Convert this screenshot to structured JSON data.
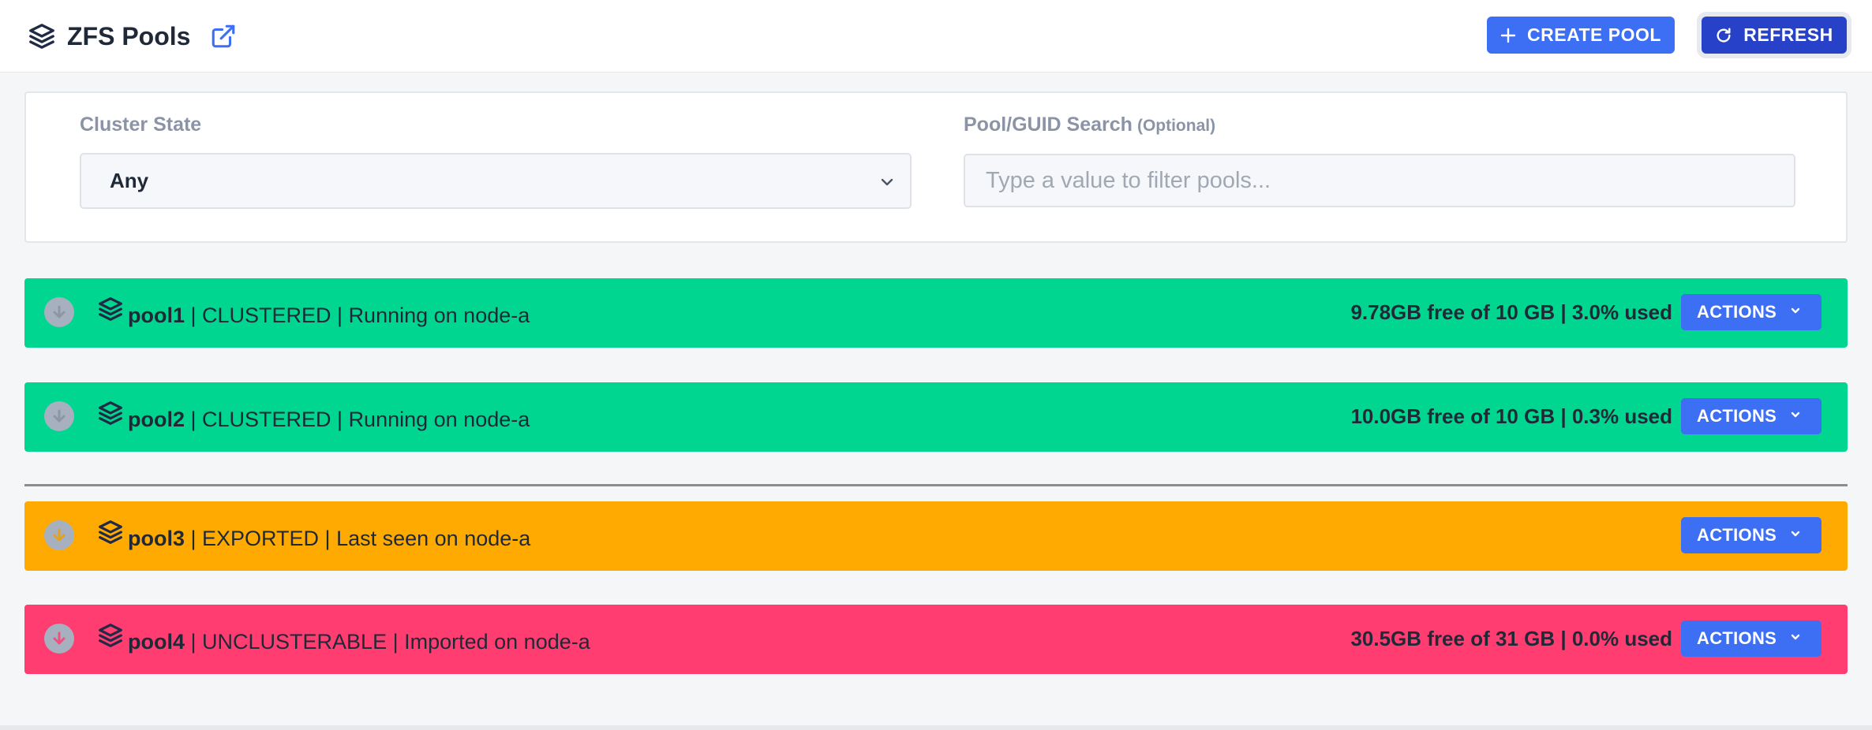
{
  "header": {
    "title": "ZFS Pools",
    "create_label": "CREATE POOL",
    "refresh_label": "REFRESH"
  },
  "filters": {
    "cluster_state_label": "Cluster State",
    "cluster_state_value": "Any",
    "search_label": "Pool/GUID Search",
    "search_optional": "(Optional)",
    "search_placeholder": "Type a value to filter pools...",
    "search_value": ""
  },
  "pools": [
    {
      "name": "pool1",
      "details": " | CLUSTERED | Running on node-a",
      "usage": "9.78GB free of 10 GB | 3.0% used",
      "state": "clustered",
      "color": "#00d68f",
      "actions_label": "ACTIONS"
    },
    {
      "name": "pool2",
      "details": " | CLUSTERED | Running on node-a",
      "usage": "10.0GB free of 10 GB | 0.3% used",
      "state": "clustered",
      "color": "#00d68f",
      "actions_label": "ACTIONS"
    },
    {
      "name": "pool3",
      "details": " | EXPORTED | Last seen on node-a",
      "usage": "",
      "state": "exported",
      "color": "#ffaa00",
      "actions_label": "ACTIONS"
    },
    {
      "name": "pool4",
      "details": " | UNCLUSTERABLE | Imported on node-a",
      "usage": "30.5GB free of 31 GB | 0.0% used",
      "state": "unclusterable",
      "color": "#ff3d71",
      "actions_label": "ACTIONS"
    }
  ],
  "colors": {
    "primary": "#3d6ff5",
    "primary_dark": "#2742c9",
    "clustered": "#00d68f",
    "exported": "#ffaa00",
    "unclusterable": "#ff3d71"
  },
  "icons": {
    "logo": "layers-icon",
    "external": "external-link-icon",
    "create": "plus-icon",
    "refresh": "refresh-icon",
    "select": "chevron-down-icon",
    "expand": "arrow-down-circle-icon",
    "pool": "layers-icon",
    "actions": "chevron-down-icon"
  }
}
